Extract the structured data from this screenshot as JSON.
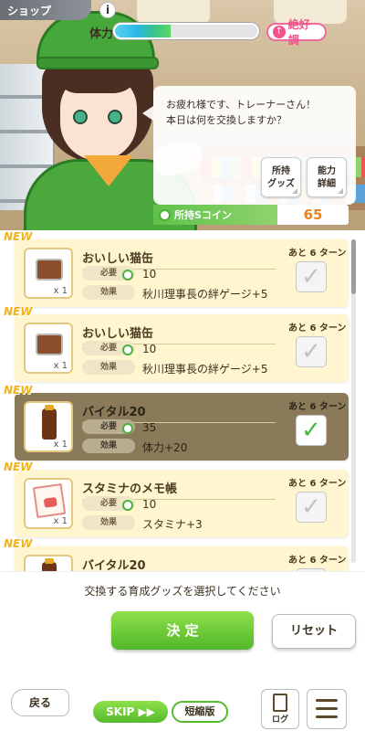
{
  "header": {
    "shop_tab": "ショップ",
    "info": "i",
    "stamina_label": "体力",
    "stamina_fraction": 0.39,
    "mood": "絶好調",
    "mood_arrow": "↑"
  },
  "dialog": {
    "line1": "お疲れ様です、トレーナーさん！",
    "line2": "本日は何を交換しますか？",
    "owned_goods_button": [
      "所持",
      "グッズ"
    ],
    "ability_button": [
      "能力",
      "詳細"
    ]
  },
  "coins": {
    "label": "所持Sコイン",
    "value": "65"
  },
  "list": {
    "labels": {
      "cost": "必要",
      "effect": "効果"
    },
    "items": [
      {
        "new": "NEW",
        "name": "おいしい猫缶",
        "cost": "10",
        "effect": "秋川理事長の絆ゲージ+5",
        "turns": "あと 6 ターン",
        "qty": "x 1",
        "icon": "cat-can-icon",
        "selected": false,
        "check": "✓"
      },
      {
        "new": "NEW",
        "name": "おいしい猫缶",
        "cost": "10",
        "effect": "秋川理事長の絆ゲージ+5",
        "turns": "あと 6 ターン",
        "qty": "x 1",
        "icon": "cat-can-icon",
        "selected": false,
        "check": "✓"
      },
      {
        "new": "NEW",
        "name": "バイタル20",
        "cost": "35",
        "effect": "体力+20",
        "turns": "あと 6 ターン",
        "qty": "x 1",
        "icon": "bottle-icon",
        "selected": true,
        "check": "✓"
      },
      {
        "new": "NEW",
        "name": "スタミナのメモ帳",
        "cost": "10",
        "effect": "スタミナ+3",
        "turns": "あと 6 ターン",
        "qty": "x 1",
        "icon": "memo-icon",
        "selected": false,
        "check": "✓"
      },
      {
        "new": "NEW",
        "name": "バイタル20",
        "cost": "",
        "effect": "",
        "turns": "あと 6 ターン",
        "qty": "",
        "icon": "bottle-icon",
        "selected": false,
        "check": "✓"
      }
    ]
  },
  "footer": {
    "instruction": "交換する育成グッズを選択してください",
    "decide": "決 定",
    "reset": "リセット",
    "back": "戻る",
    "skip": "SKIP ▶▶",
    "short": "短縮版",
    "log": "ログ"
  }
}
